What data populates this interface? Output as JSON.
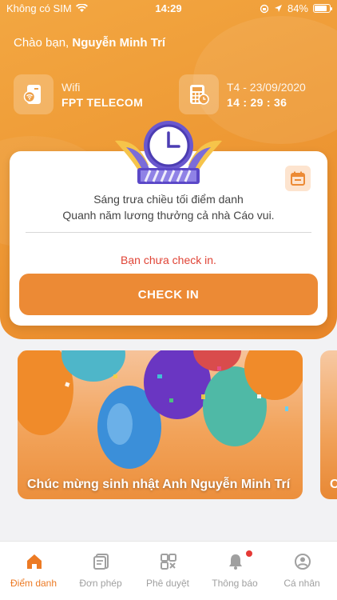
{
  "status_bar": {
    "carrier": "Không có SIM",
    "time": "14:29",
    "battery": "84%"
  },
  "greeting": {
    "prefix": "Chào bạn,",
    "name": "Nguyễn Minh Trí"
  },
  "wifi": {
    "label": "Wifi",
    "value": "FPT TELECOM"
  },
  "date": {
    "label": "T4 - 23/09/2020",
    "time": "14 : 29 : 36"
  },
  "card": {
    "slogan_line1": "Sáng trưa chiều tối điểm danh",
    "slogan_line2": "Quanh năm lương thưởng cả nhà Cáo vui.",
    "status": "Bạn chưa check in.",
    "button": "CHECK IN"
  },
  "banner": {
    "caption": "Chúc mừng sinh nhật Anh Nguyễn Minh Trí",
    "peek_caption": "C"
  },
  "tabs": [
    {
      "label": "Điểm danh",
      "icon": "home-icon",
      "active": true
    },
    {
      "label": "Đơn phép",
      "icon": "document-icon",
      "active": false
    },
    {
      "label": "Phê duyệt",
      "icon": "approval-grid-icon",
      "active": false
    },
    {
      "label": "Thông báo",
      "icon": "bell-icon",
      "active": false
    },
    {
      "label": "Cá nhân",
      "icon": "user-icon",
      "active": false
    }
  ],
  "colors": {
    "accent": "#ec8a35",
    "alert": "#e04436",
    "active_tab": "#ec7a24"
  }
}
